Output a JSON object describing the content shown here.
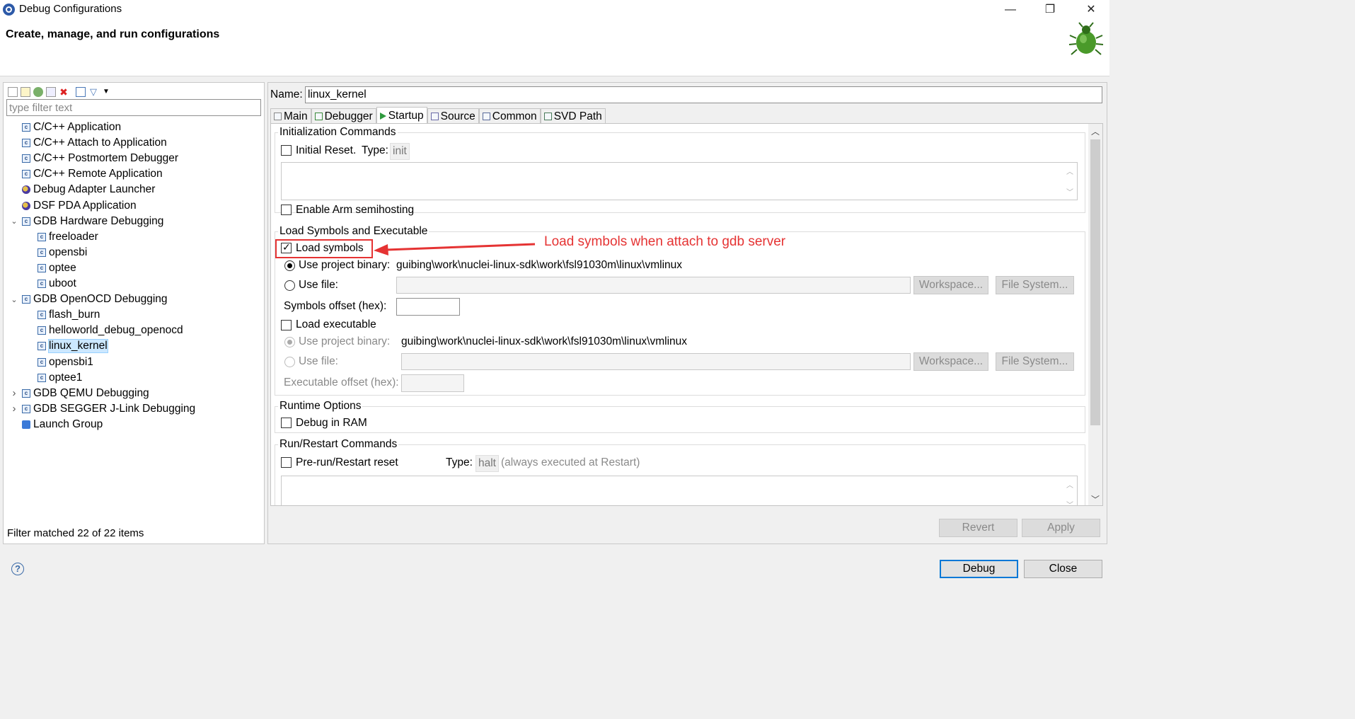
{
  "window": {
    "title": "Debug Configurations",
    "minimize": "—",
    "restore": "❐",
    "close": "✕"
  },
  "header": {
    "title": "Create, manage, and run configurations"
  },
  "left": {
    "filter_placeholder": "type filter text",
    "tree": [
      {
        "label": "C/C++ Application",
        "icon": "c-config-icon",
        "level": 0
      },
      {
        "label": "C/C++ Attach to Application",
        "icon": "c-config-icon",
        "level": 0
      },
      {
        "label": "C/C++ Postmortem Debugger",
        "icon": "c-config-icon",
        "level": 0
      },
      {
        "label": "C/C++ Remote Application",
        "icon": "c-config-icon",
        "level": 0
      },
      {
        "label": "Debug Adapter Launcher",
        "icon": "gear-config-icon",
        "level": 0
      },
      {
        "label": "DSF PDA Application",
        "icon": "gear-config-icon",
        "level": 0
      },
      {
        "label": "GDB Hardware Debugging",
        "icon": "c-config-icon",
        "level": 0,
        "expanded": true
      },
      {
        "label": "freeloader",
        "icon": "c-config-icon",
        "level": 1
      },
      {
        "label": "opensbi",
        "icon": "c-config-icon",
        "level": 1
      },
      {
        "label": "optee",
        "icon": "c-config-icon",
        "level": 1
      },
      {
        "label": "uboot",
        "icon": "c-config-icon",
        "level": 1
      },
      {
        "label": "GDB OpenOCD Debugging",
        "icon": "c-config-icon",
        "level": 0,
        "expanded": true
      },
      {
        "label": "flash_burn",
        "icon": "c-config-icon",
        "level": 1
      },
      {
        "label": "helloworld_debug_openocd",
        "icon": "c-config-icon",
        "level": 1
      },
      {
        "label": "linux_kernel",
        "icon": "c-config-icon",
        "level": 1,
        "selected": true
      },
      {
        "label": "opensbi1",
        "icon": "c-config-icon",
        "level": 1
      },
      {
        "label": "optee1",
        "icon": "c-config-icon",
        "level": 1
      },
      {
        "label": "GDB QEMU Debugging",
        "icon": "c-config-icon",
        "level": 0,
        "expanded": false
      },
      {
        "label": "GDB SEGGER J-Link Debugging",
        "icon": "c-config-icon",
        "level": 0,
        "expanded": false
      },
      {
        "label": "Launch Group",
        "icon": "launch-group-icon",
        "level": 0
      }
    ],
    "status": "Filter matched 22 of 22 items"
  },
  "right": {
    "name_label": "Name:",
    "name_value": "linux_kernel",
    "tabs": [
      {
        "label": "Main",
        "icon": "main-tab-icon"
      },
      {
        "label": "Debugger",
        "icon": "debugger-tab-icon"
      },
      {
        "label": "Startup",
        "icon": "startup-tab-icon",
        "active": true
      },
      {
        "label": "Source",
        "icon": "source-tab-icon"
      },
      {
        "label": "Common",
        "icon": "common-tab-icon"
      },
      {
        "label": "SVD Path",
        "icon": "svd-tab-icon"
      }
    ],
    "init": {
      "title": "Initialization Commands",
      "initial_reset": "Initial Reset.",
      "type_label": "Type:",
      "type_value": "init",
      "semihosting": "Enable Arm semihosting"
    },
    "load": {
      "title": "Load Symbols and Executable",
      "load_symbols": "Load symbols",
      "use_project_binary": "Use project binary:",
      "symbols_path": "guibing\\work\\nuclei-linux-sdk\\work\\fsl91030m\\linux\\vmlinux",
      "use_file": "Use file:",
      "workspace": "Workspace...",
      "file_system": "File System...",
      "symbols_offset": "Symbols offset (hex):",
      "load_executable": "Load executable",
      "exec_path": "guibing\\work\\nuclei-linux-sdk\\work\\fsl91030m\\linux\\vmlinux",
      "exec_offset": "Executable offset (hex):"
    },
    "runtime": {
      "title": "Runtime Options",
      "debug_in_ram": "Debug in RAM"
    },
    "restart": {
      "title": "Run/Restart Commands",
      "prerun": "Pre-run/Restart reset",
      "type_label": "Type:",
      "type_value": "halt",
      "note": "(always executed at Restart)"
    },
    "revert": "Revert",
    "apply": "Apply"
  },
  "annotation": {
    "text": "Load symbols when attach to gdb server",
    "color": "#e53333"
  },
  "footer": {
    "debug": "Debug",
    "close": "Close"
  }
}
